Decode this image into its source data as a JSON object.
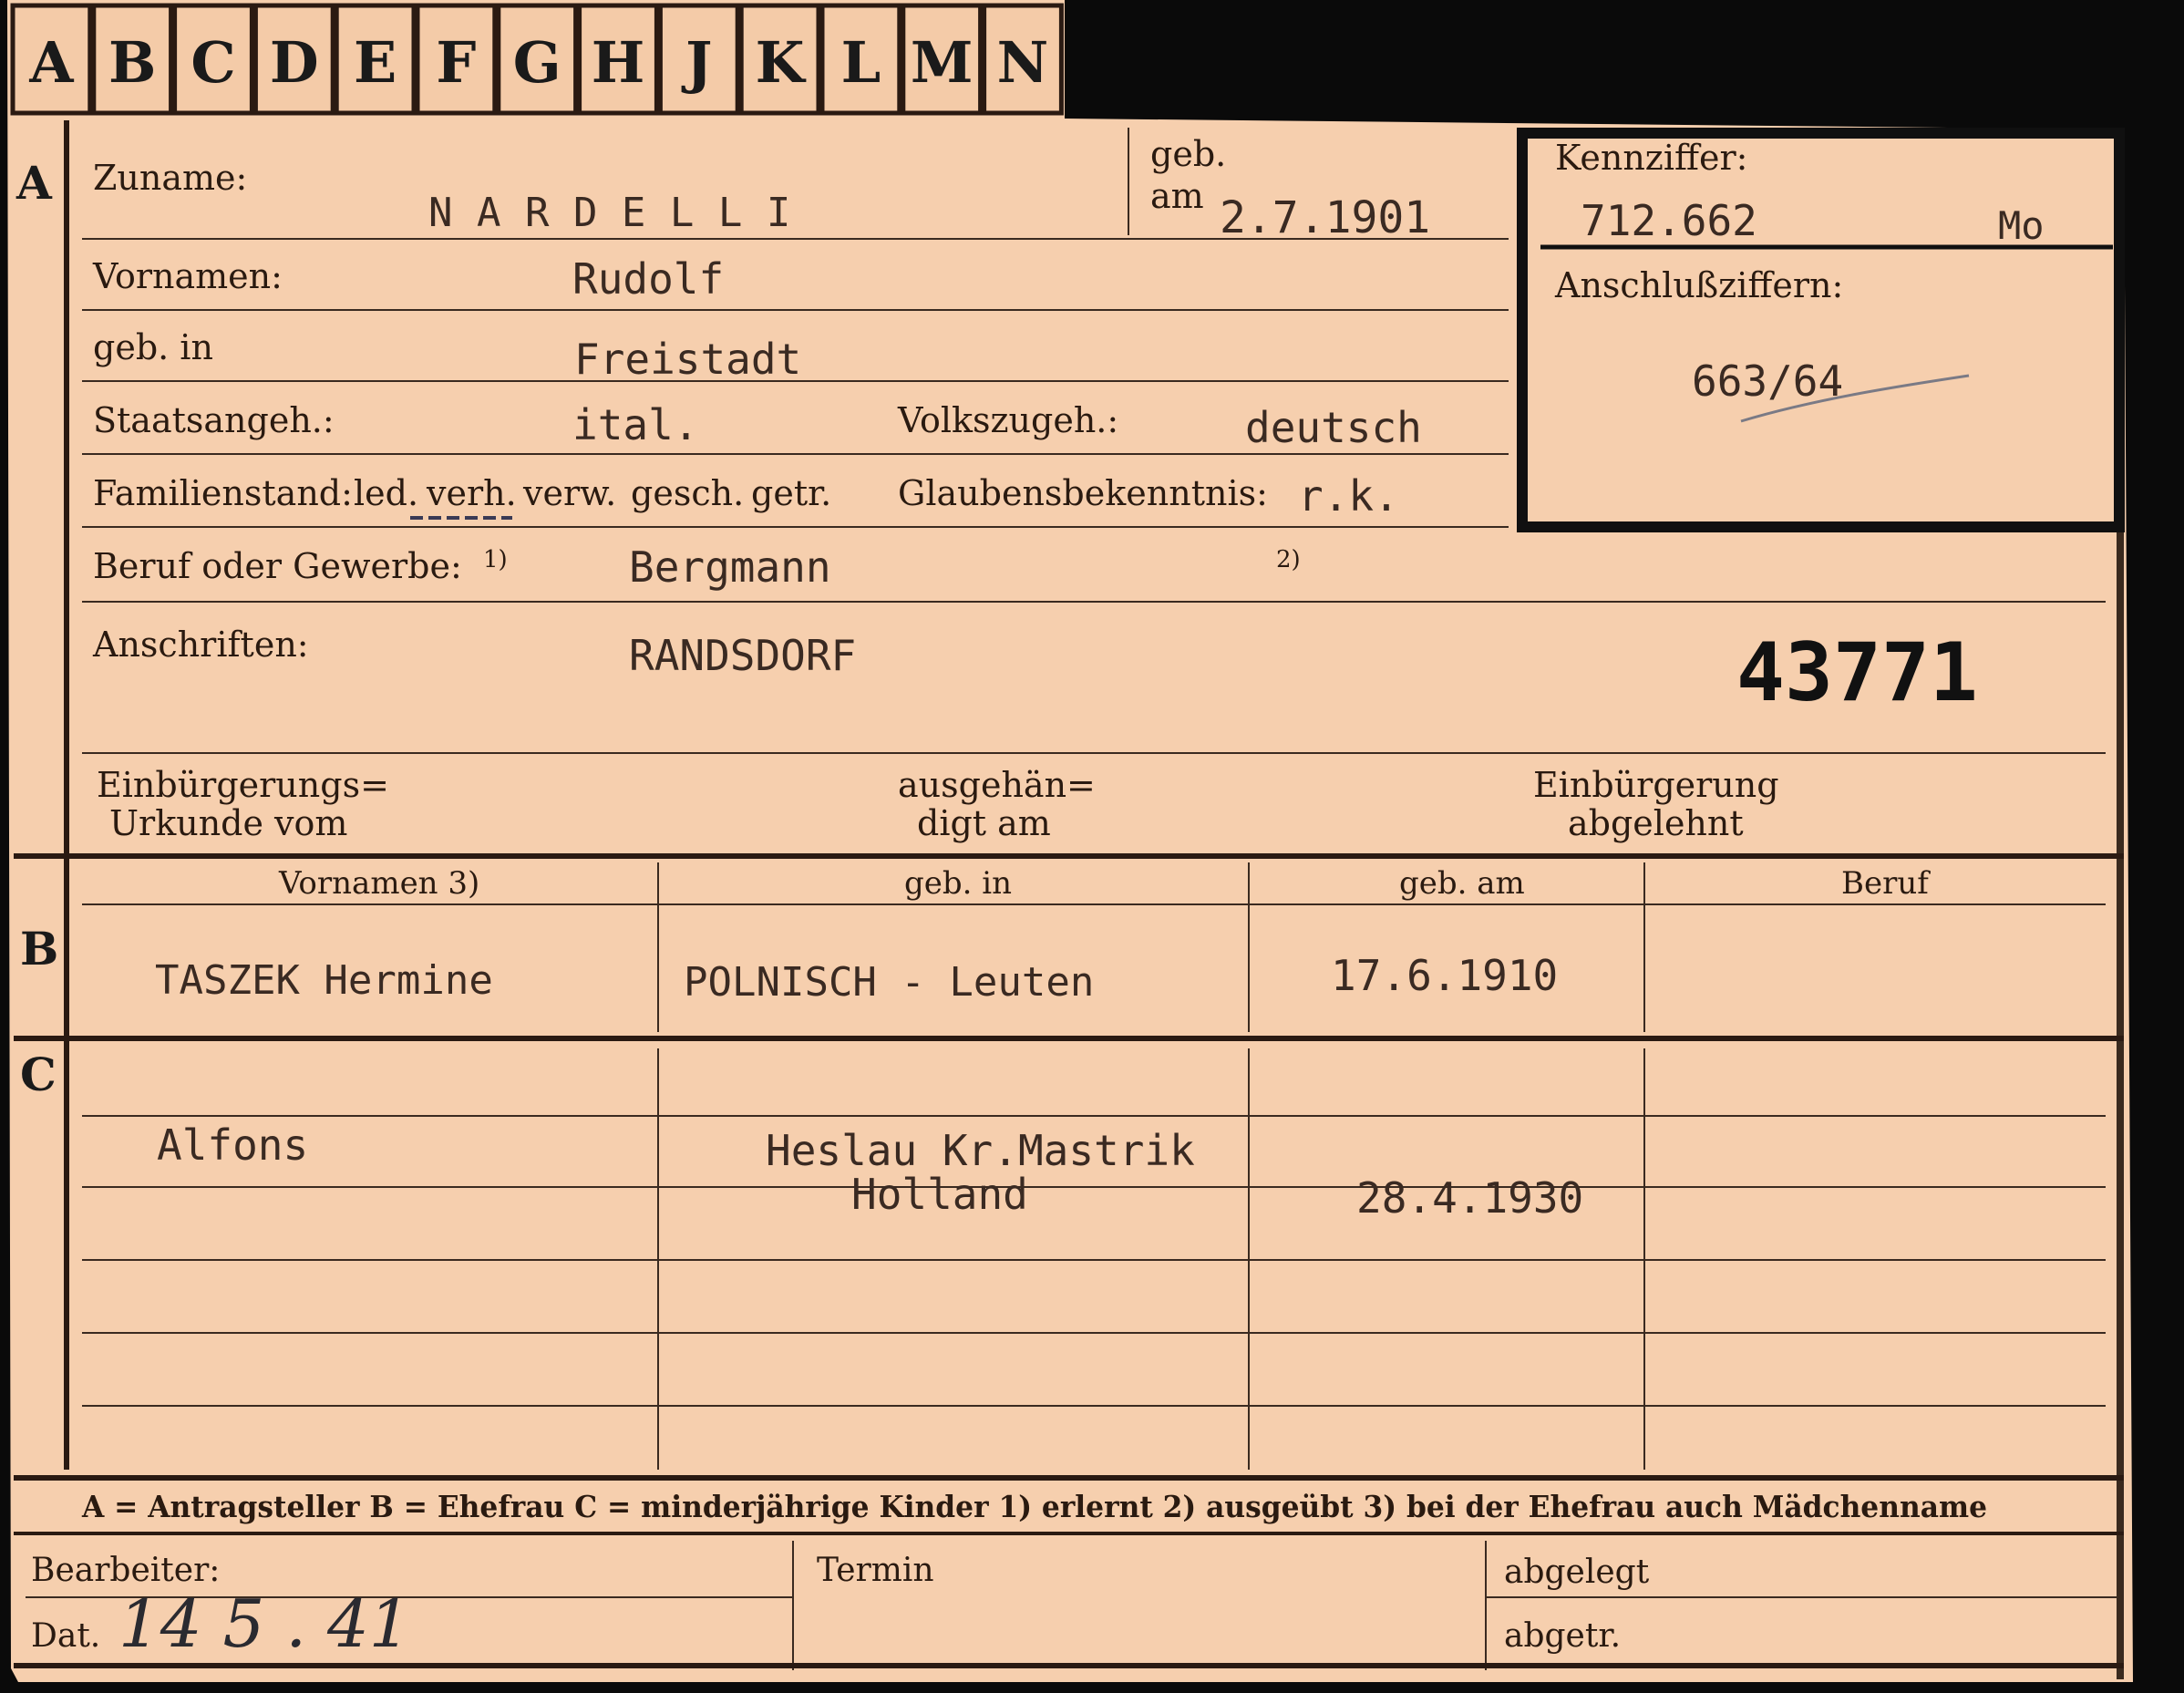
{
  "tabs": [
    "A",
    "B",
    "C",
    "D",
    "E",
    "F",
    "G",
    "H",
    "J",
    "K",
    "L",
    "M",
    "N"
  ],
  "sections": {
    "a": "A",
    "b": "B",
    "c": "C"
  },
  "applicant": {
    "surname_label": "Zuname:",
    "surname": "N A R D E L L I",
    "born_on_label_1": "geb.",
    "born_on_label_2": "am",
    "born_on": "2.7.1901",
    "firstnames_label": "Vornamen:",
    "firstnames": "Rudolf",
    "birthplace_label": "geb. in",
    "birthplace": "Freistadt",
    "citizenship_label": "Staatsangeh.:",
    "citizenship": "ital.",
    "ethnicity_label": "Volkszugeh.:",
    "ethnicity": "deutsch",
    "marital_label": "Familienstand:",
    "marital_options": [
      "led.",
      "verh.",
      "verw.",
      "gesch.",
      "getr."
    ],
    "religion_label": "Glaubensbekenntnis:",
    "religion": "r.k.",
    "occupation_label": "Beruf oder Gewerbe:",
    "footnote_1": "1)",
    "occupation": "Bergmann",
    "footnote_2": "2)",
    "address_label": "Anschriften:",
    "address": "RANDSDORF",
    "stamp_number": "43771",
    "naturalization_label_1": "Einbürgerungs=",
    "naturalization_label_2": "Urkunde vom",
    "handed_label_1": "ausgehän=",
    "handed_label_2": "digt am",
    "rejected_label_1": "Einbürgerung",
    "rejected_label_2": "abgelehnt"
  },
  "id_box": {
    "id_label": "Kennziffer:",
    "id_value": "712.662",
    "id_suffix": "Mo",
    "linked_label": "Anschlußziffern:",
    "linked_value": "663/64"
  },
  "spouse": {
    "headers": [
      "Vornamen 3)",
      "geb. in",
      "geb. am",
      "Beruf"
    ],
    "name": "TASZEK Hermine",
    "birthplace": "POLNISCH - Leuten",
    "born_on": "17.6.1910",
    "occupation": ""
  },
  "children": {
    "name": "Alfons",
    "birthplace_1": "Heslau Kr.Mastrik",
    "birthplace_2": "Holland",
    "born_on": "28.4.1930"
  },
  "legend": "A = Antragsteller   B = Ehefrau   C = minderjährige Kinder   1) erlernt   2) ausgeübt   3) bei der Ehefrau auch Mädchenname",
  "footer": {
    "clerk_label": "Bearbeiter:",
    "date_label": "Dat.",
    "date_value": "14 5 . 41",
    "deadline_label": "Termin",
    "filed_label": "abgelegt",
    "sent_label": "abgetr."
  }
}
